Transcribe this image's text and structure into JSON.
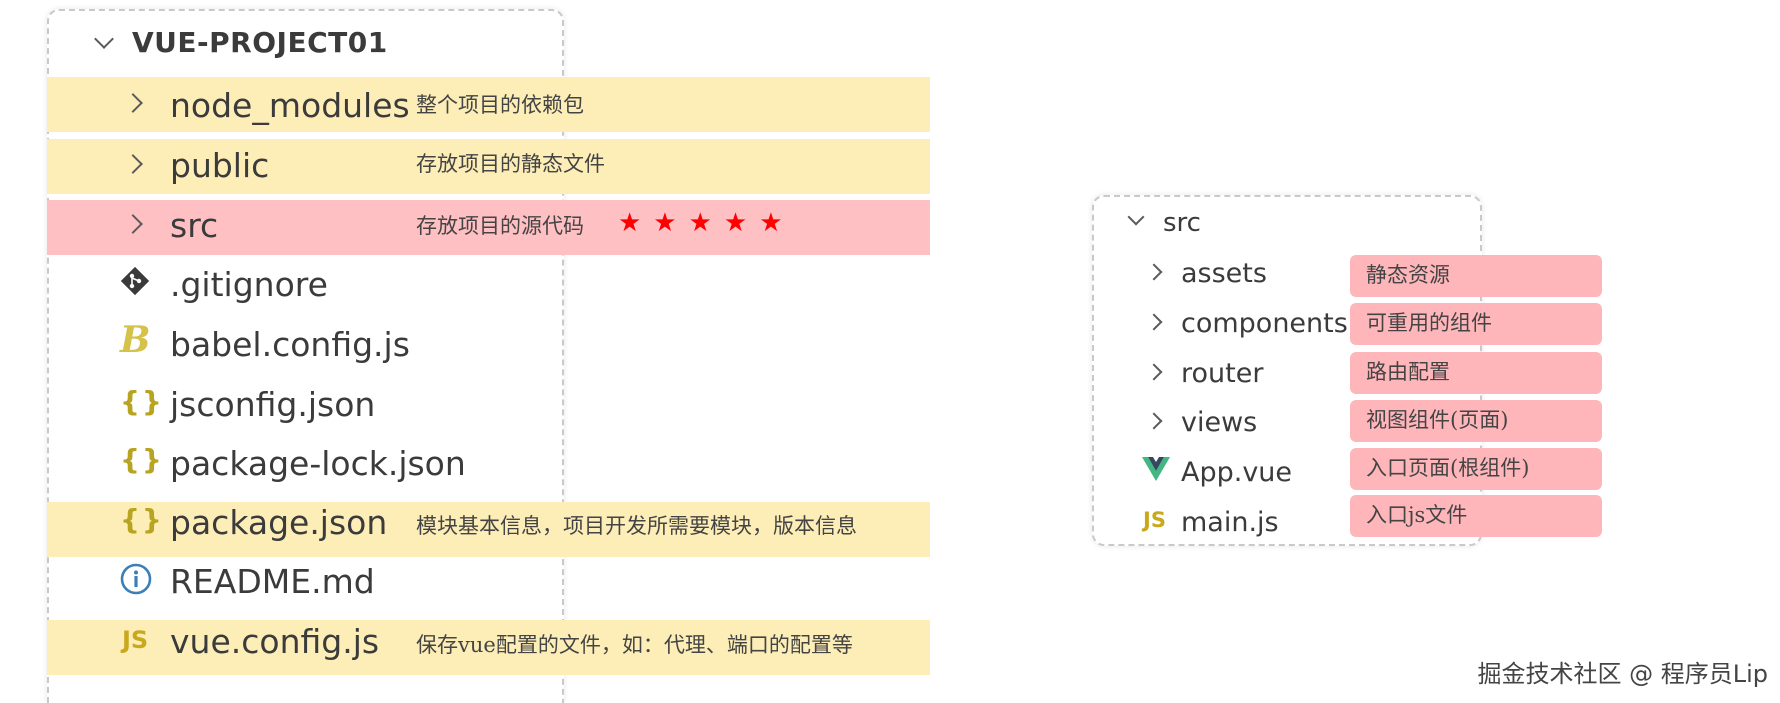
{
  "left": {
    "project": "VUE-PROJECT01",
    "items": [
      {
        "name": "node_modules",
        "note": "整个项目的依赖包"
      },
      {
        "name": "public",
        "note": "存放项目的静态文件"
      },
      {
        "name": "src",
        "note": "存放项目的源代码",
        "stars": "★★★★★"
      },
      {
        "name": ".gitignore"
      },
      {
        "name": "babel.config.js"
      },
      {
        "name": "jsconfig.json",
        "icon": "{}"
      },
      {
        "name": "package-lock.json",
        "icon": "{}"
      },
      {
        "name": "package.json",
        "icon": "{}",
        "note": "模块基本信息，项目开发所需要模块，版本信息"
      },
      {
        "name": "README.md"
      },
      {
        "name": "vue.config.js",
        "icon": "JS",
        "note": "保存vue配置的文件，如：代理、端口的配置等"
      }
    ]
  },
  "right": {
    "root": "src",
    "items": [
      {
        "name": "assets",
        "tag": "静态资源"
      },
      {
        "name": "components",
        "tag": "可重用的组件"
      },
      {
        "name": "router",
        "tag": "路由配置"
      },
      {
        "name": "views",
        "tag": "视图组件(页面)"
      },
      {
        "name": "App.vue",
        "tag": "入口页面(根组件)"
      },
      {
        "name": "main.js",
        "icon": "JS",
        "tag": "入口js文件"
      }
    ]
  },
  "watermark": "掘金技术社区 @ 程序员Lip",
  "colors": {
    "highlight_yellow": "#fdeeb8",
    "highlight_pink": "#ffc0c4",
    "tag_pink": "#ffb6bb",
    "star_red": "#ff0000",
    "json_icon": "#b8a420",
    "js_icon": "#c9a81c",
    "vue_green": "#41b883",
    "babel_yellow": "#d4c24a",
    "info_blue": "#3c7fb8"
  },
  "icons": {
    "folder_collapsed": "chevron-right-icon",
    "folder_expanded": "chevron-down-icon",
    "gitignore": "git-icon",
    "babel": "babel-icon",
    "json": "json-braces-icon",
    "readme": "info-icon",
    "js": "js-icon",
    "vue": "vue-icon"
  }
}
